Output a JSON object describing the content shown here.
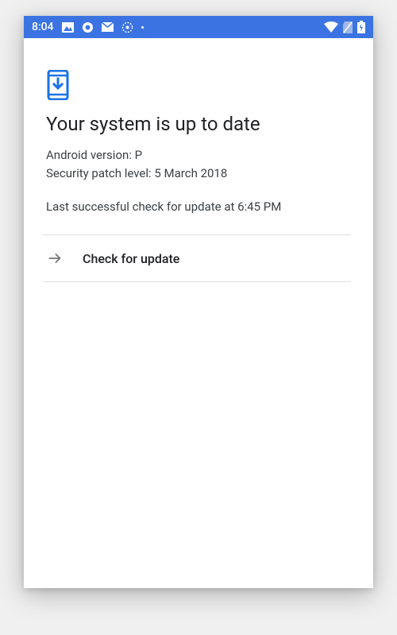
{
  "status_bar": {
    "time": "8:04",
    "icons": {
      "picture": "picture-icon",
      "circle": "circle-icon",
      "mail": "mail-icon",
      "target": "target-icon",
      "wifi": "wifi-icon",
      "sim": "sim-icon",
      "battery": "battery-icon"
    }
  },
  "update": {
    "title": "Your system is up to date",
    "android_version_line": "Android version: P",
    "security_patch_line": "Security patch level: 5 March 2018",
    "last_check": "Last successful check for update at 6:45 PM",
    "action_label": "Check for update"
  }
}
